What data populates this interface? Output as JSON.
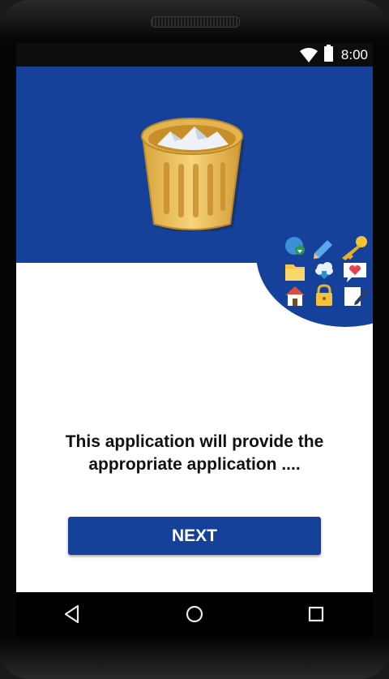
{
  "status_bar": {
    "time": "8:00",
    "wifi_icon": "wifi-icon",
    "battery_icon": "battery-icon"
  },
  "hero": {
    "background": "#15419b",
    "illustration": "recycle-bin-icon",
    "app_icons": [
      "globe-download-icon",
      "pencil-icon",
      "key-icon",
      "folder-icon",
      "cloud-download-icon",
      "heart-chat-icon",
      "home-icon",
      "lock-icon",
      "notepad-icon"
    ]
  },
  "message": {
    "line1": "This application will provide the",
    "line2": "appropriate application ...."
  },
  "next_button": {
    "label": "NEXT",
    "color": "#15419b"
  },
  "nav_bar": {
    "back": "back-icon",
    "home": "home-circle-icon",
    "recents": "recents-icon"
  }
}
